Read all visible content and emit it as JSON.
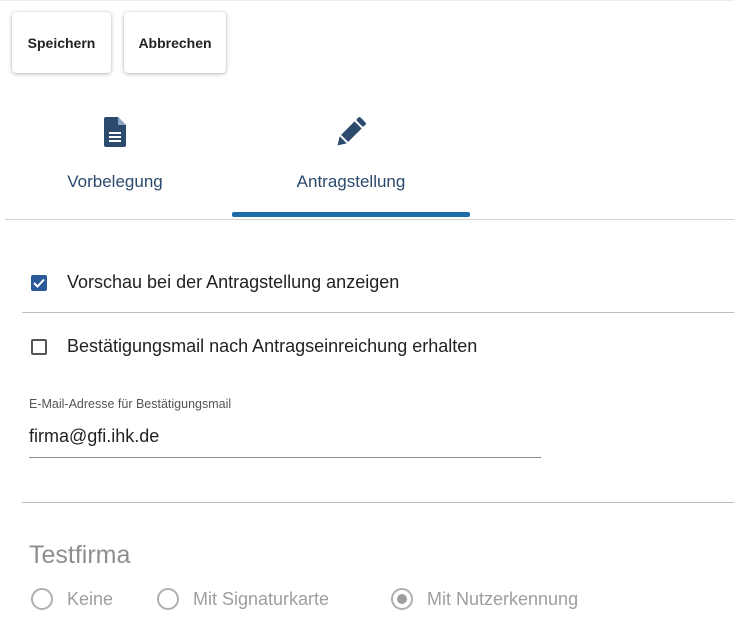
{
  "toolbar": {
    "save_label": "Speichern",
    "cancel_label": "Abbrechen"
  },
  "tabs": [
    {
      "label": "Vorbelegung",
      "icon": "document-icon",
      "active": false
    },
    {
      "label": "Antragstellung",
      "icon": "pencil-icon",
      "active": true
    }
  ],
  "options": {
    "preview": {
      "label": "Vorschau bei der Antragstellung anzeigen",
      "checked": true
    },
    "confirmation_mail": {
      "label": "Bestätigungsmail nach Antragseinreichung erhalten",
      "checked": false
    }
  },
  "email_field": {
    "label": "E-Mail-Adresse für Bestätigungsmail",
    "value": "firma@gfi.ihk.de"
  },
  "testfirma": {
    "title": "Testfirma",
    "radios": [
      {
        "label": "Keine",
        "selected": false
      },
      {
        "label": "Mit Signaturkarte",
        "selected": false
      },
      {
        "label": "Mit Nutzerkennung",
        "selected": true
      }
    ]
  },
  "colors": {
    "accent": "#1e6dab",
    "tab_text": "#2c4a6e",
    "checkbox_checked": "#2a5a9a",
    "disabled": "#9e9e9e"
  }
}
